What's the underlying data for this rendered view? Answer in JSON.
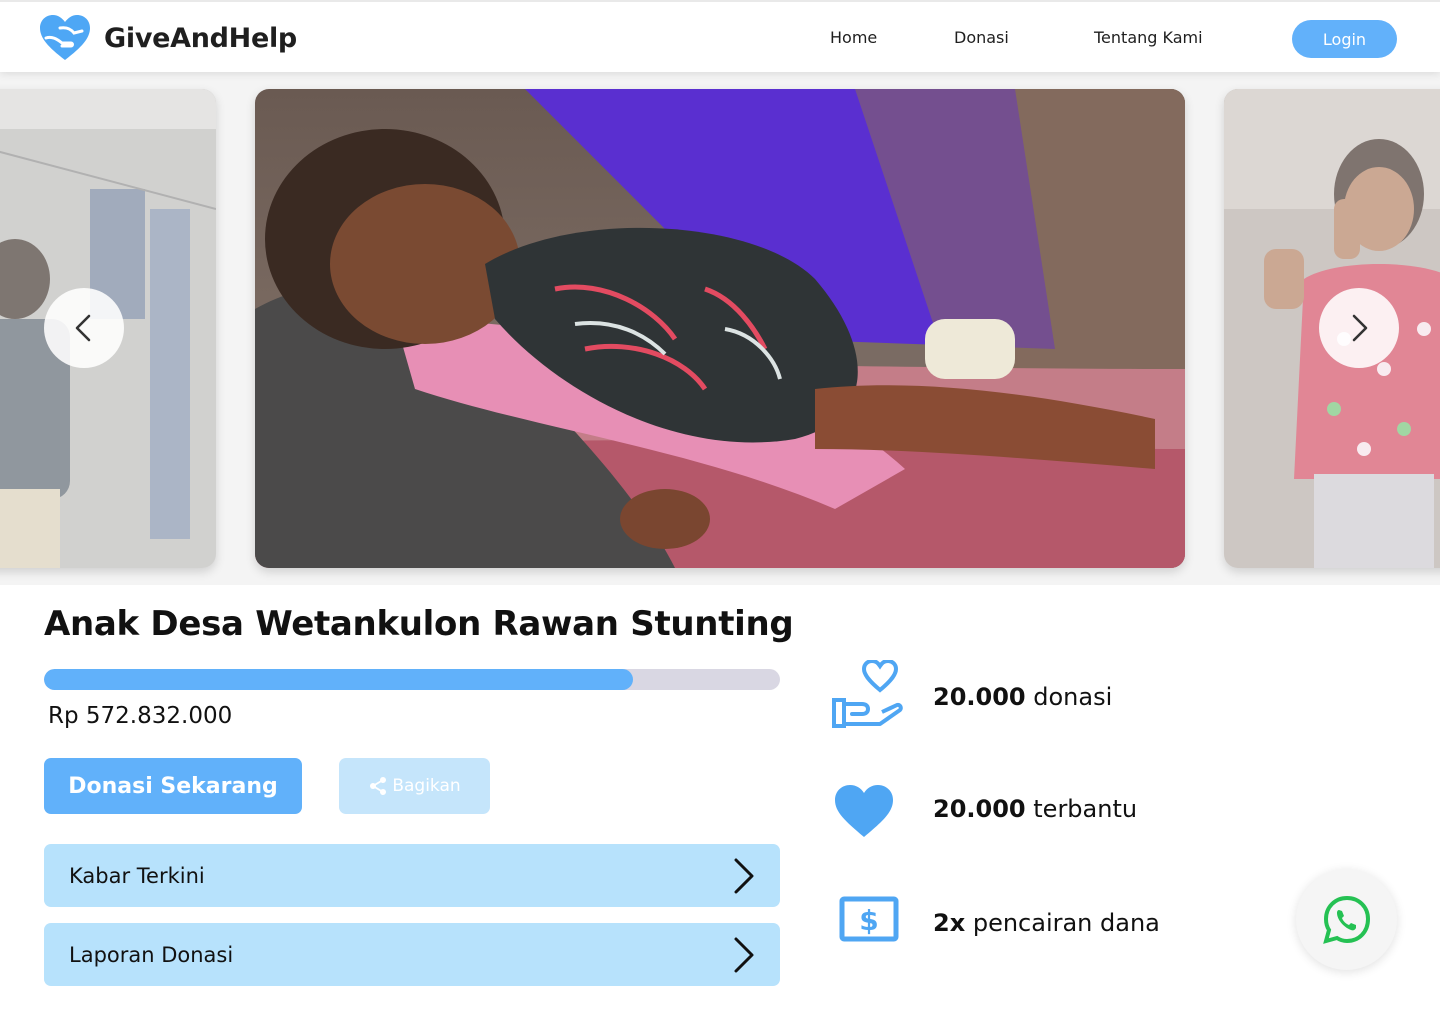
{
  "brand": {
    "name": "GiveAndHelp",
    "logo_icon": "heart-hands-logo",
    "accent_color": "#61b1fa"
  },
  "nav": {
    "items": [
      "Home",
      "Donasi",
      "Tentang Kami"
    ],
    "login_label": "Login"
  },
  "carousel": {
    "prev_icon": "chevron-left-icon",
    "next_icon": "chevron-right-icon"
  },
  "campaign": {
    "title": "Anak Desa Wetankulon Rawan Stunting",
    "amount": "Rp 572.832.000",
    "progress": 0.8,
    "donate_label": "Donasi Sekarang",
    "share_label": "Bagikan",
    "sections": [
      "Kabar Terkini",
      "Laporan Donasi"
    ]
  },
  "stats": [
    {
      "icon": "hand-heart-icon",
      "value": "20.000",
      "label": "donasi"
    },
    {
      "icon": "heart-icon",
      "value": "20.000",
      "label": "terbantu"
    },
    {
      "icon": "cash-icon",
      "value": "2x",
      "label": "pencairan dana"
    }
  ],
  "whatsapp": {
    "icon": "whatsapp-icon"
  }
}
